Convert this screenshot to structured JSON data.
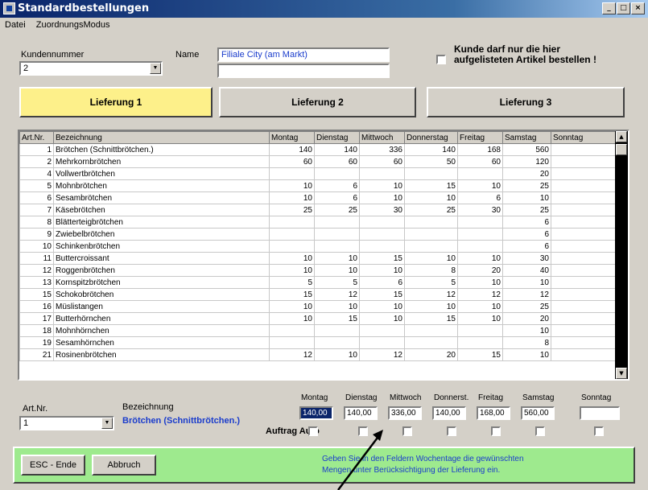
{
  "window": {
    "title": "Standardbestellungen",
    "min": "_",
    "max": "□",
    "close": "×"
  },
  "menu": [
    "Datei",
    "ZuordnungsModus"
  ],
  "kunde": {
    "nr_label": "Kundennummer",
    "nr_value": "2",
    "name_label": "Name",
    "name_value": "Filiale City (am Markt)",
    "name2_value": ""
  },
  "restrict_label": "Kunde darf nur die hier aufgelisteten Artikel bestellen !",
  "tabs": [
    {
      "label": "Lieferung 1",
      "active": true
    },
    {
      "label": "Lieferung 2",
      "active": false
    },
    {
      "label": "Lieferung 3",
      "active": false
    }
  ],
  "table": {
    "headers": [
      "Art.Nr.",
      "Bezeichnung",
      "Montag",
      "Dienstag",
      "Mittwoch",
      "Donnerstag",
      "Freitag",
      "Samstag",
      "Sonntag"
    ],
    "rows": [
      [
        "1",
        "Brötchen (Schnittbrötchen.)",
        "140",
        "140",
        "336",
        "140",
        "168",
        "560",
        ""
      ],
      [
        "2",
        "Mehrkornbrötchen",
        "60",
        "60",
        "60",
        "50",
        "60",
        "120",
        ""
      ],
      [
        "4",
        "Vollwertbrötchen",
        "",
        "",
        "",
        "",
        "",
        "20",
        ""
      ],
      [
        "5",
        "Mohnbrötchen",
        "10",
        "6",
        "10",
        "15",
        "10",
        "25",
        ""
      ],
      [
        "6",
        "Sesambrötchen",
        "10",
        "6",
        "10",
        "10",
        "6",
        "10",
        ""
      ],
      [
        "7",
        "Käsebrötchen",
        "25",
        "25",
        "30",
        "25",
        "30",
        "25",
        ""
      ],
      [
        "8",
        "Blätterteigbrötchen",
        "",
        "",
        "",
        "",
        "",
        "6",
        ""
      ],
      [
        "9",
        "Zwiebelbrötchen",
        "",
        "",
        "",
        "",
        "",
        "6",
        ""
      ],
      [
        "10",
        "Schinkenbrötchen",
        "",
        "",
        "",
        "",
        "",
        "6",
        ""
      ],
      [
        "11",
        "Buttercroissant",
        "10",
        "10",
        "15",
        "10",
        "10",
        "30",
        ""
      ],
      [
        "12",
        "Roggenbrötchen",
        "10",
        "10",
        "10",
        "8",
        "20",
        "40",
        ""
      ],
      [
        "13",
        "Kornspitzbrötchen",
        "5",
        "5",
        "6",
        "5",
        "10",
        "10",
        ""
      ],
      [
        "15",
        "Schokobrötchen",
        "15",
        "12",
        "15",
        "12",
        "12",
        "12",
        ""
      ],
      [
        "16",
        "Müslistangen",
        "10",
        "10",
        "10",
        "10",
        "10",
        "25",
        ""
      ],
      [
        "17",
        "Butterhörnchen",
        "10",
        "15",
        "10",
        "15",
        "10",
        "20",
        ""
      ],
      [
        "18",
        "Mohnhörnchen",
        "",
        "",
        "",
        "",
        "",
        "10",
        ""
      ],
      [
        "19",
        "Sesamhörnchen",
        "",
        "",
        "",
        "",
        "",
        "8",
        ""
      ],
      [
        "21",
        "Rosinenbrötchen",
        "12",
        "10",
        "12",
        "20",
        "15",
        "10",
        ""
      ]
    ]
  },
  "detail": {
    "artnr_label": "Art.Nr.",
    "artnr_value": "1",
    "bez_label": "Bezeichnung",
    "bez_value": "Brötchen (Schnittbrötchen.)",
    "auto_label": "Auftrag Auto",
    "days": [
      "Montag",
      "Dienstag",
      "Mittwoch",
      "Donnerst.",
      "Freitag",
      "Samstag",
      "Sonntag"
    ],
    "values": [
      "140,00",
      "140,00",
      "336,00",
      "140,00",
      "168,00",
      "560,00",
      ""
    ]
  },
  "buttons": {
    "esc": "ESC - Ende",
    "abbruch": "Abbruch"
  },
  "hint": [
    "Geben Sie in den Feldern Wochentage die gewünschten",
    "Mengen unter Berücksichtigung der Lieferung ein."
  ],
  "colors": {
    "active_tab": "#fdf08a",
    "status_bar": "#9eea8e",
    "title_bar": "#0a246a",
    "blue_text": "#1a3ccc"
  }
}
